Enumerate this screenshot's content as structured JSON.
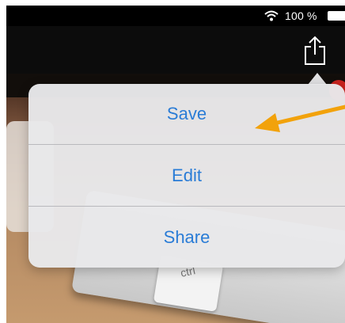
{
  "status_bar": {
    "battery_text": "100 %",
    "icons": [
      "wifi-icon",
      "battery-icon"
    ]
  },
  "toolbar": {
    "share_icon": "share-icon"
  },
  "menu": {
    "items": [
      {
        "label": "Save"
      },
      {
        "label": "Edit"
      },
      {
        "label": "Share"
      }
    ]
  },
  "background_photo": {
    "key_label": "ctrl"
  },
  "annotation": {
    "icon": "arrow-icon",
    "color": "#f2a20b"
  },
  "colors": {
    "accent": "#2a7cd6",
    "popover_bg": "#e8e8ea",
    "bar_bg": "#0c0c0c"
  }
}
